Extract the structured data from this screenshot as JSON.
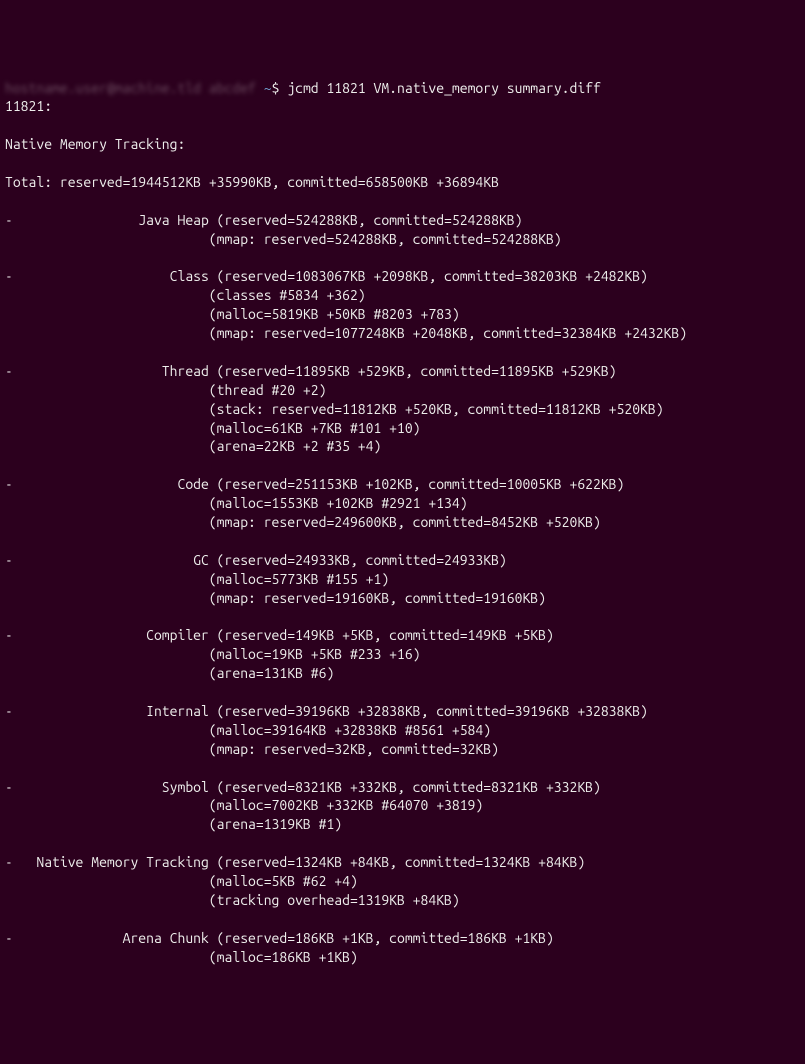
{
  "prompt": {
    "host_blur": "hostname.user@machine.tld abcdef",
    "tilde": "~",
    "dollar": "$",
    "command": "jcmd 11821 VM.native_memory summary.diff"
  },
  "pid_line": "11821:",
  "header": "Native Memory Tracking:",
  "total": "Total: reserved=1944512KB +35990KB, committed=658500KB +36894KB",
  "sections": [
    {
      "name": "Java Heap",
      "line": "(reserved=524288KB, committed=524288KB)",
      "subs": [
        "(mmap: reserved=524288KB, committed=524288KB)"
      ]
    },
    {
      "name": "Class",
      "line": "(reserved=1083067KB +2098KB, committed=38203KB +2482KB)",
      "subs": [
        "(classes #5834 +362)",
        "(malloc=5819KB +50KB #8203 +783)",
        "(mmap: reserved=1077248KB +2048KB, committed=32384KB +2432KB)"
      ]
    },
    {
      "name": "Thread",
      "line": "(reserved=11895KB +529KB, committed=11895KB +529KB)",
      "subs": [
        "(thread #20 +2)",
        "(stack: reserved=11812KB +520KB, committed=11812KB +520KB)",
        "(malloc=61KB +7KB #101 +10)",
        "(arena=22KB +2 #35 +4)"
      ]
    },
    {
      "name": "Code",
      "line": "(reserved=251153KB +102KB, committed=10005KB +622KB)",
      "subs": [
        "(malloc=1553KB +102KB #2921 +134)",
        "(mmap: reserved=249600KB, committed=8452KB +520KB)"
      ]
    },
    {
      "name": "GC",
      "line": "(reserved=24933KB, committed=24933KB)",
      "subs": [
        "(malloc=5773KB #155 +1)",
        "(mmap: reserved=19160KB, committed=19160KB)"
      ]
    },
    {
      "name": "Compiler",
      "line": "(reserved=149KB +5KB, committed=149KB +5KB)",
      "subs": [
        "(malloc=19KB +5KB #233 +16)",
        "(arena=131KB #6)"
      ]
    },
    {
      "name": "Internal",
      "line": "(reserved=39196KB +32838KB, committed=39196KB +32838KB)",
      "subs": [
        "(malloc=39164KB +32838KB #8561 +584)",
        "(mmap: reserved=32KB, committed=32KB)"
      ]
    },
    {
      "name": "Symbol",
      "line": "(reserved=8321KB +332KB, committed=8321KB +332KB)",
      "subs": [
        "(malloc=7002KB +332KB #64070 +3819)",
        "(arena=1319KB #1)"
      ]
    },
    {
      "name": "Native Memory Tracking",
      "line": "(reserved=1324KB +84KB, committed=1324KB +84KB)",
      "subs": [
        "(malloc=5KB #62 +4)",
        "(tracking overhead=1319KB +84KB)"
      ]
    },
    {
      "name": "Arena Chunk",
      "line": "(reserved=186KB +1KB, committed=186KB +1KB)",
      "subs": [
        "(malloc=186KB +1KB)"
      ]
    }
  ]
}
